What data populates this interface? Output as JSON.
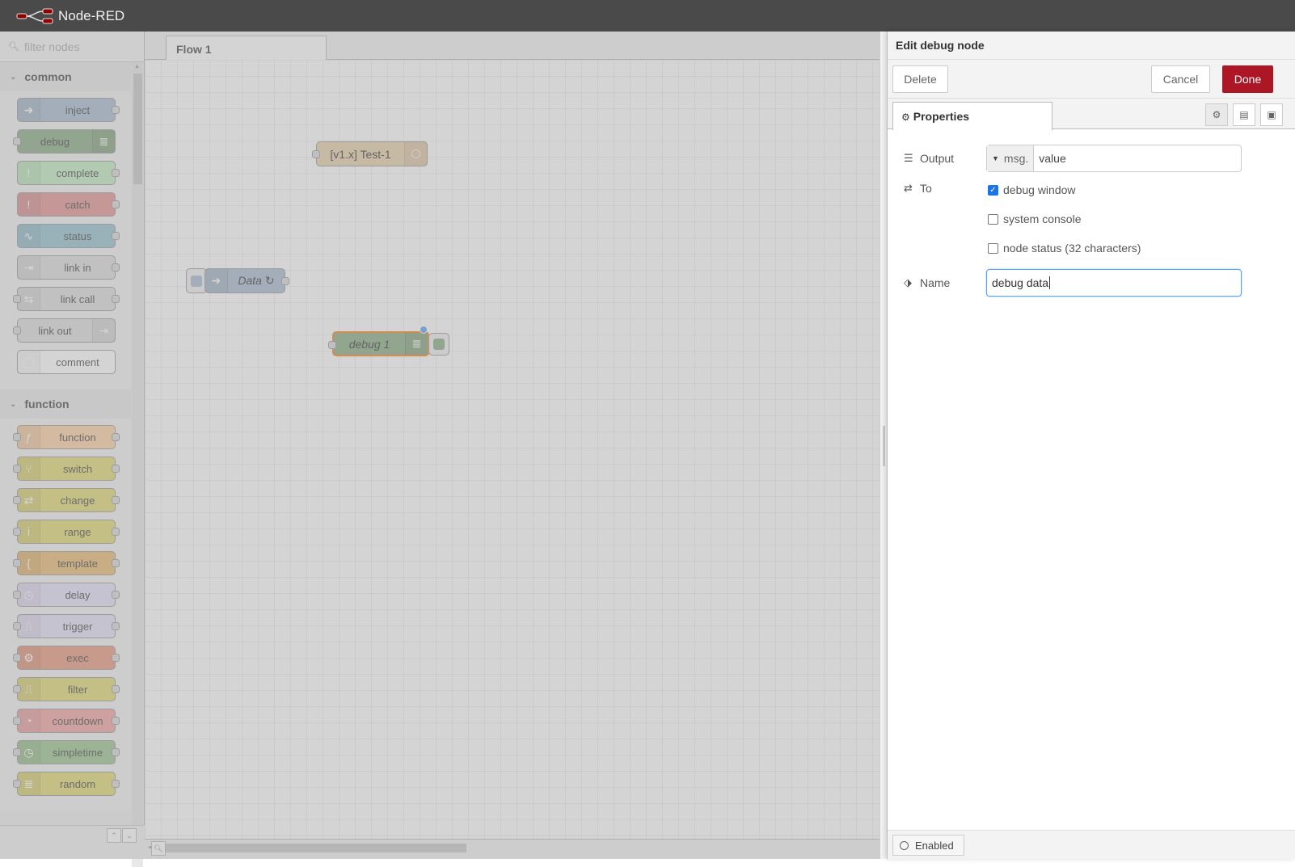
{
  "app": {
    "title": "Node-RED"
  },
  "palette": {
    "search_placeholder": "filter nodes",
    "categories": [
      {
        "name": "common",
        "nodes": [
          {
            "label": "inject",
            "color": "#a6bbcf",
            "icon": "arrow-right-icon",
            "in": false,
            "out": true,
            "iconRight": false
          },
          {
            "label": "debug",
            "color": "#87a980",
            "icon": "list-icon",
            "in": true,
            "out": false,
            "iconRight": true
          },
          {
            "label": "complete",
            "color": "#c0edc0",
            "icon": "exclamation-icon",
            "in": false,
            "out": true,
            "iconRight": false
          },
          {
            "label": "catch",
            "color": "#e49191",
            "icon": "exclamation-icon",
            "in": false,
            "out": true,
            "iconRight": false
          },
          {
            "label": "status",
            "color": "#94c1d0",
            "icon": "pulse-icon",
            "in": false,
            "out": true,
            "iconRight": false
          },
          {
            "label": "link in",
            "color": "#dddddd",
            "icon": "link-in-icon",
            "in": false,
            "out": true,
            "iconRight": false
          },
          {
            "label": "link call",
            "color": "#dddddd",
            "icon": "link-icon",
            "in": true,
            "out": true,
            "iconRight": false
          },
          {
            "label": "link out",
            "color": "#dddddd",
            "icon": "link-out-icon",
            "in": true,
            "out": false,
            "iconRight": true
          },
          {
            "label": "comment",
            "color": "#ffffff",
            "icon": "speech-icon",
            "in": false,
            "out": false,
            "iconRight": false
          }
        ]
      },
      {
        "name": "function",
        "nodes": [
          {
            "label": "function",
            "color": "#fdd0a2",
            "icon": "function-icon",
            "in": true,
            "out": true,
            "iconRight": false
          },
          {
            "label": "switch",
            "color": "#e2d96e",
            "icon": "switch-icon",
            "in": true,
            "out": true,
            "iconRight": false
          },
          {
            "label": "change",
            "color": "#e2d96e",
            "icon": "shuffle-icon",
            "in": true,
            "out": true,
            "iconRight": false
          },
          {
            "label": "range",
            "color": "#e2d96e",
            "icon": "range-icon",
            "in": true,
            "out": true,
            "iconRight": false
          },
          {
            "label": "template",
            "color": "#ebb96e",
            "icon": "brace-icon",
            "in": true,
            "out": true,
            "iconRight": false
          },
          {
            "label": "delay",
            "color": "#e6e0f8",
            "icon": "clock-icon",
            "in": true,
            "out": true,
            "iconRight": false
          },
          {
            "label": "trigger",
            "color": "#e6e0f8",
            "icon": "trigger-icon",
            "in": true,
            "out": true,
            "iconRight": false
          },
          {
            "label": "exec",
            "color": "#e9967a",
            "icon": "gear-icon",
            "in": true,
            "out": true,
            "iconRight": false
          },
          {
            "label": "filter",
            "color": "#e2d96e",
            "icon": "filter-icon",
            "in": true,
            "out": true,
            "iconRight": false
          },
          {
            "label": "countdown",
            "color": "#f4a3a3",
            "icon": "timer-icon",
            "in": true,
            "out": true,
            "iconRight": false
          },
          {
            "label": "simpletime",
            "color": "#9ac48c",
            "icon": "clock-icon",
            "in": true,
            "out": true,
            "iconRight": false
          },
          {
            "label": "random",
            "color": "#e2d96e",
            "icon": "list-icon",
            "in": true,
            "out": true,
            "iconRight": false
          }
        ]
      }
    ]
  },
  "workspace": {
    "tab_label": "Flow 1",
    "nodes": {
      "test": "[v1.x] Test-1",
      "data": "Data ↻",
      "debug": "debug 1"
    }
  },
  "tray": {
    "title": "Edit debug node",
    "delete_label": "Delete",
    "cancel_label": "Cancel",
    "done_label": "Done",
    "tab_properties": "Properties",
    "output_label": "Output",
    "output_type": "msg.",
    "output_value": "value",
    "to_label": "To",
    "to_debug_window": "debug window",
    "to_system_console": "system console",
    "to_node_status": "node status (32 characters)",
    "name_label": "Name",
    "name_value": "debug data",
    "enabled_label": "Enabled"
  },
  "colors": {
    "header": "#4a4a4a",
    "done_button": "#ad1625",
    "checkbox_checked": "#1a73e8"
  }
}
